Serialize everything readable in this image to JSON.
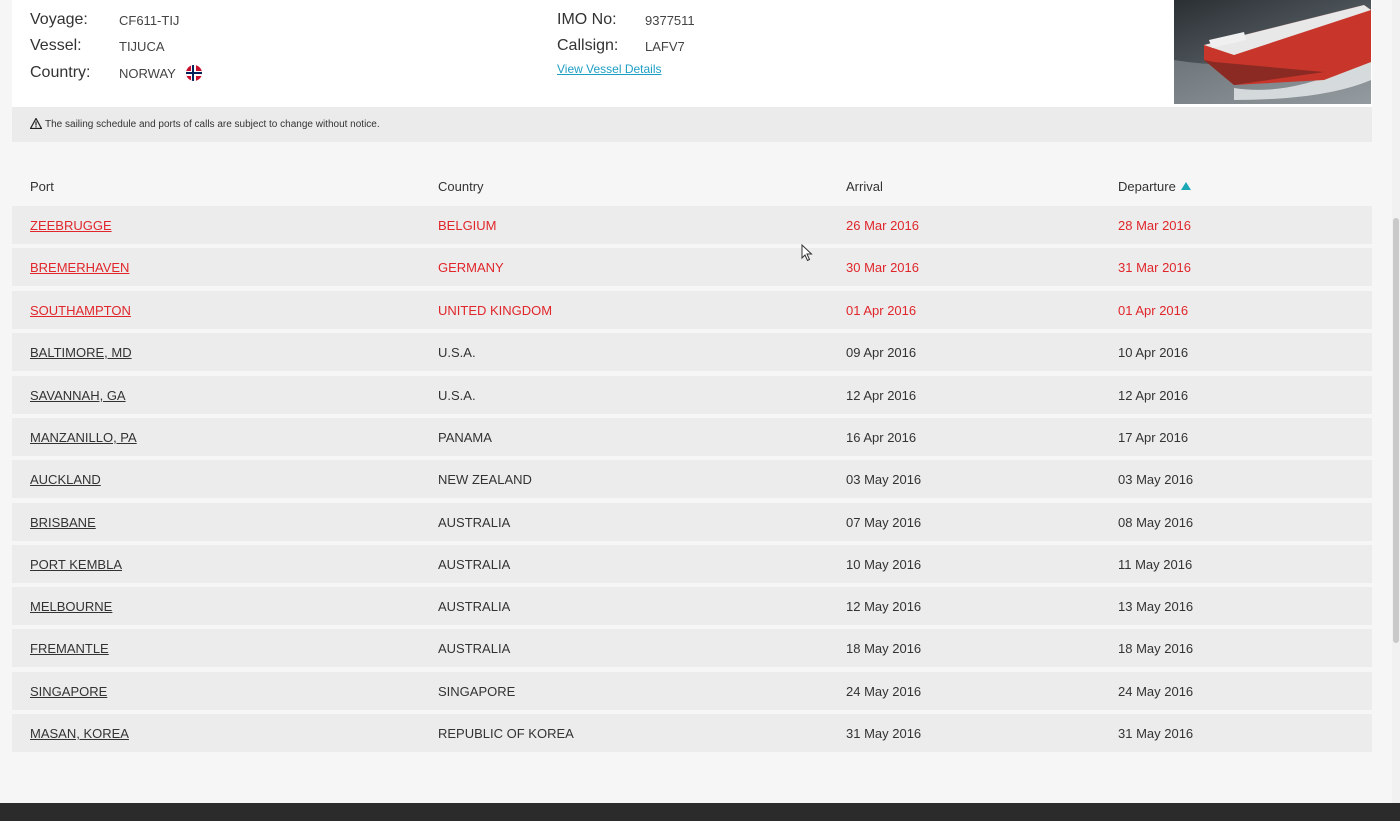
{
  "vessel_info": {
    "voyage_label": "Voyage:",
    "voyage": "CF611-TIJ",
    "vessel_label": "Vessel:",
    "vessel": "TIJUCA",
    "country_label": "Country:",
    "country": "NORWAY",
    "imo_label": "IMO No:",
    "imo": "9377511",
    "callsign_label": "Callsign:",
    "callsign": "LAFV7",
    "view_details": "View Vessel Details"
  },
  "notice": "The sailing schedule and ports of calls are subject to change without notice.",
  "schedule": {
    "headers": {
      "port": "Port",
      "country": "Country",
      "arrival": "Arrival",
      "departure": "Departure"
    },
    "rows": [
      {
        "port": "ZEEBRUGGE",
        "country": "BELGIUM",
        "arrival": "26 Mar 2016",
        "departure": "28 Mar 2016"
      },
      {
        "port": "BREMERHAVEN",
        "country": "GERMANY",
        "arrival": "30 Mar 2016",
        "departure": "31 Mar 2016"
      },
      {
        "port": "SOUTHAMPTON",
        "country": "UNITED KINGDOM",
        "arrival": "01 Apr 2016",
        "departure": "01 Apr 2016"
      },
      {
        "port": "BALTIMORE, MD",
        "country": "U.S.A.",
        "arrival": "09 Apr 2016",
        "departure": "10 Apr 2016"
      },
      {
        "port": "SAVANNAH, GA",
        "country": "U.S.A.",
        "arrival": "12 Apr 2016",
        "departure": "12 Apr 2016"
      },
      {
        "port": "MANZANILLO, PA",
        "country": "PANAMA",
        "arrival": "16 Apr 2016",
        "departure": "17 Apr 2016"
      },
      {
        "port": "AUCKLAND",
        "country": "NEW ZEALAND",
        "arrival": "03 May 2016",
        "departure": "03 May 2016"
      },
      {
        "port": "BRISBANE",
        "country": "AUSTRALIA",
        "arrival": "07 May 2016",
        "departure": "08 May 2016"
      },
      {
        "port": "PORT KEMBLA",
        "country": "AUSTRALIA",
        "arrival": "10 May 2016",
        "departure": "11 May 2016"
      },
      {
        "port": "MELBOURNE",
        "country": "AUSTRALIA",
        "arrival": "12 May 2016",
        "departure": "13 May 2016"
      },
      {
        "port": "FREMANTLE",
        "country": "AUSTRALIA",
        "arrival": "18 May 2016",
        "departure": "18 May 2016"
      },
      {
        "port": "SINGAPORE",
        "country": "SINGAPORE",
        "arrival": "24 May 2016",
        "departure": "24 May 2016"
      },
      {
        "port": "MASAN, KOREA",
        "country": "REPUBLIC OF KOREA",
        "arrival": "31 May 2016",
        "departure": "31 May 2016"
      }
    ]
  },
  "colors": {
    "highlight": "#e0262b",
    "accent": "#1aa7b6",
    "link": "#1d9ec4"
  },
  "icons": {
    "warning": "warning-icon",
    "sort": "sort-ascending-icon",
    "flag": "norway-flag-icon"
  }
}
